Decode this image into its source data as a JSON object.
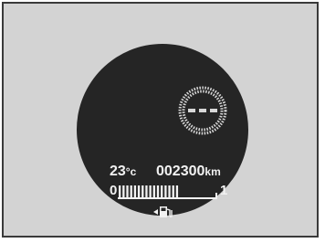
{
  "display": {
    "temperature": "23",
    "temperature_unit": "°c",
    "odometer": "002300",
    "odometer_unit": "km"
  },
  "fuel_gauge": {
    "empty_label": "0",
    "full_label": "1",
    "segments_total": 16,
    "segments_lit": 16,
    "level_fraction": 0.62
  },
  "colors": {
    "frame_bg": "#d3d3d3",
    "dial_bg": "#252525",
    "text": "#f2f2f2",
    "ring": "#d8d8d8"
  },
  "icons": [
    "speed-ring-icon",
    "fuel-pump-icon",
    "arrow-left-icon"
  ]
}
